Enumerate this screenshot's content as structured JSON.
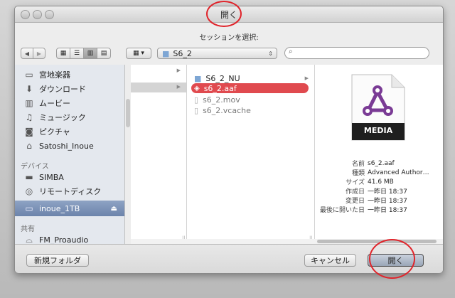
{
  "window": {
    "title": "開く",
    "subtitle": "セッションを選択:"
  },
  "toolbar": {
    "back": "◀",
    "forward": "▶",
    "location": "S6_2",
    "search_placeholder": ""
  },
  "sidebar": {
    "favorites": [
      {
        "label": "宮地楽器",
        "icon": "folder-icon"
      },
      {
        "label": "ダウンロード",
        "icon": "download-icon"
      },
      {
        "label": "ムービー",
        "icon": "film-icon"
      },
      {
        "label": "ミュージック",
        "icon": "music-icon"
      },
      {
        "label": "ピクチャ",
        "icon": "camera-icon"
      },
      {
        "label": "Satoshi_Inoue",
        "icon": "home-icon"
      }
    ],
    "devices_header": "デバイス",
    "devices": [
      {
        "label": "SIMBA",
        "icon": "computer-icon"
      },
      {
        "label": "リモートディスク",
        "icon": "disc-icon"
      },
      {
        "label": "inoue_1TB",
        "icon": "drive-icon",
        "selected": true,
        "eject": "⏏"
      }
    ],
    "shared_header": "共有",
    "shared": [
      {
        "label": "FM_Proaudio",
        "icon": "network-icon"
      }
    ]
  },
  "column2": {
    "items": [
      {
        "label": "S6_2_NU",
        "icon": "folder-icon"
      },
      {
        "label": "s6_2.aaf",
        "icon": "aaf-icon",
        "selected": true
      },
      {
        "label": "s6_2.mov",
        "icon": "file-icon"
      },
      {
        "label": "s6_2.vcache",
        "icon": "file-icon"
      }
    ]
  },
  "preview": {
    "badge": "MEDIA",
    "info": [
      {
        "k": "名前",
        "v": "s6_2.aaf"
      },
      {
        "k": "種類",
        "v": "Advanced Author…"
      },
      {
        "k": "サイズ",
        "v": "41.6 MB"
      },
      {
        "k": "作成日",
        "v": "一昨日 18:37"
      },
      {
        "k": "変更日",
        "v": "一昨日 18:37"
      },
      {
        "k": "最後に開いた日",
        "v": "一昨日 18:37"
      }
    ]
  },
  "buttons": {
    "new_folder": "新規フォルダ",
    "cancel": "キャンセル",
    "open": "開く"
  },
  "colors": {
    "selection": "#e04a4f",
    "sidebar_selection": "#7a90b5",
    "annotation": "#e0242b"
  }
}
